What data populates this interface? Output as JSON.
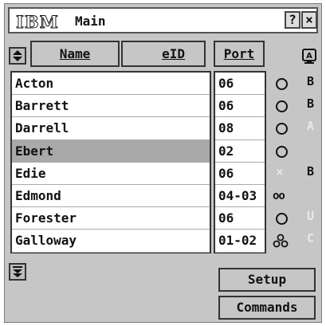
{
  "titlebar": {
    "logo": "IBM",
    "title": "Main",
    "help_label": "?",
    "close_label": "×"
  },
  "table": {
    "headers": {
      "name": "Name",
      "eid": "eID",
      "port": "Port"
    },
    "rows": [
      {
        "name": "Acton",
        "port": "06",
        "status": "circle",
        "channel": "B",
        "selected": false
      },
      {
        "name": "Barrett",
        "port": "06",
        "status": "circle",
        "channel": "B",
        "selected": false
      },
      {
        "name": "Darrell",
        "port": "08",
        "status": "circle",
        "channel": "",
        "selected": false
      },
      {
        "name": "Ebert",
        "port": "02",
        "status": "circle",
        "channel": "",
        "selected": true
      },
      {
        "name": "Edie",
        "port": "06",
        "status": "x-dim",
        "channel": "B",
        "selected": false
      },
      {
        "name": "Edmond",
        "port": "04-03",
        "status": "double-circle",
        "channel": "",
        "selected": false
      },
      {
        "name": "Forester",
        "port": "06",
        "status": "circle",
        "channel": "",
        "selected": false
      },
      {
        "name": "Galloway",
        "port": "01-02",
        "status": "triple-circle",
        "channel": "",
        "selected": false
      }
    ]
  },
  "buttons": {
    "setup": "Setup",
    "commands": "Commands"
  },
  "icons": {
    "sort": "sort-arrows-icon",
    "scroll": "scroll-down-icon",
    "monitor": "monitor-icon"
  }
}
